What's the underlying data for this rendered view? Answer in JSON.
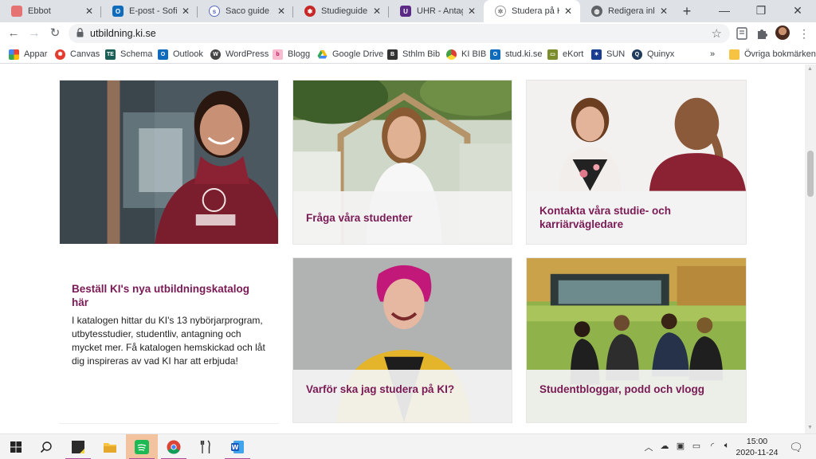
{
  "tabs": [
    {
      "title": "Ebbot",
      "icon": "ebbot-favicon",
      "color": "#e57373"
    },
    {
      "title": "E-post - Sofia A",
      "icon": "outlook-favicon",
      "color": "#0f6cbd"
    },
    {
      "title": "Saco guide",
      "icon": "saco-favicon",
      "color": "#5c6bc0"
    },
    {
      "title": "Studieguide rep",
      "icon": "studieguide-favicon",
      "color": "#c62828"
    },
    {
      "title": "UHR - Antagning",
      "icon": "uhr-favicon",
      "color": "#5b2a86"
    },
    {
      "title": "Studera på Karo",
      "icon": "ki-favicon",
      "color": "#9e9e9e"
    },
    {
      "title": "Redigera inlägg",
      "icon": "globe-favicon",
      "color": "#5f6368"
    }
  ],
  "toolbar": {
    "url": "utbildning.ki.se"
  },
  "bookmarks": [
    {
      "label": "Appar",
      "icon": "apps-grid-icon",
      "color": "#d93025"
    },
    {
      "label": "Canvas",
      "icon": "canvas-icon",
      "color": "#e33b2e"
    },
    {
      "label": "Schema",
      "icon": "te-icon",
      "color": "#1b5e56"
    },
    {
      "label": "Outlook",
      "icon": "outlook-icon",
      "color": "#0f6cbd"
    },
    {
      "label": "WordPress",
      "icon": "wordpress-icon",
      "color": "#464646"
    },
    {
      "label": "Blogg",
      "icon": "blogg-icon",
      "color": "#c2185b"
    },
    {
      "label": "Google Drive",
      "icon": "google-drive-icon",
      "color": "#34a853"
    },
    {
      "label": "Sthlm Bib",
      "icon": "sthlm-bib-icon",
      "color": "#333333"
    },
    {
      "label": "KI BIB",
      "icon": "ki-bib-icon",
      "color": "#f4a300"
    },
    {
      "label": "stud.ki.se",
      "icon": "stud-ki-icon",
      "color": "#0f6cbd"
    },
    {
      "label": "eKort",
      "icon": "ekort-icon",
      "color": "#7b8c2b"
    },
    {
      "label": "SUN",
      "icon": "sun-icon",
      "color": "#1a3d8f"
    },
    {
      "label": "Quinyx",
      "icon": "quinyx-icon",
      "color": "#1f3a5a"
    },
    {
      "label": "»",
      "icon": "more-bookmarks-icon",
      "color": "#5f6368"
    },
    {
      "label": "Övriga bokmärken",
      "icon": "folder-icon",
      "color": "#f6c343"
    }
  ],
  "cards": {
    "catalog": {
      "title": "Beställ KI's nya utbildningskatalog här",
      "text": "I katalogen hittar du KI's 13 nybörjarprogram, utbytesstudier, studentliv, antagning och mycket mer.  Få katalogen hemskickad och låt dig inspireras av vad KI har att erbjuda!"
    },
    "students": {
      "title": "Fråga våra studenter"
    },
    "contact": {
      "title": "Kontakta våra studie- och karriärvägledare"
    },
    "why": {
      "title": "Varför ska jag studera på KI?"
    },
    "blogs": {
      "title": "Studentbloggar, podd och vlogg"
    }
  },
  "colors": {
    "accent": "#7a1a55"
  },
  "taskbar": {
    "time": "15:00",
    "date": "2020-11-24"
  }
}
